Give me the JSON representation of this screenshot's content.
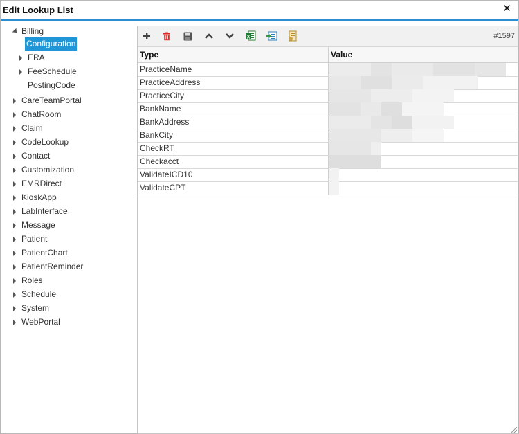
{
  "window": {
    "title": "Edit Lookup List",
    "close_glyph": "✕"
  },
  "tree": {
    "billing": "Billing",
    "configuration": "Configuration",
    "era": "ERA",
    "feeschedule": "FeeSchedule",
    "postingcode": "PostingCode",
    "items": [
      "CareTeamPortal",
      "ChatRoom",
      "Claim",
      "CodeLookup",
      "Contact",
      "Customization",
      "EMRDirect",
      "KioskApp",
      "LabInterface",
      "Message",
      "Patient",
      "PatientChart",
      "PatientReminder",
      "Roles",
      "Schedule",
      "System",
      "WebPortal"
    ]
  },
  "toolbar": {
    "icons": [
      "add-icon",
      "delete-icon",
      "save-icon",
      "move-up-icon",
      "move-down-icon",
      "excel-export-icon",
      "import-icon",
      "audit-icon"
    ],
    "record_id": "#1597"
  },
  "grid": {
    "columns": [
      "Type",
      "Value"
    ],
    "rows": [
      "PracticeName",
      "PracticeAddress",
      "PracticeCity",
      "BankName",
      "BankAddress",
      "BankCity",
      "CheckRT",
      "Checkacct",
      "ValidateICD10",
      "ValidateCPT"
    ]
  },
  "colors": {
    "accent": "#2a8ed0",
    "selected": "#2196d6",
    "delete": "#e02828"
  }
}
